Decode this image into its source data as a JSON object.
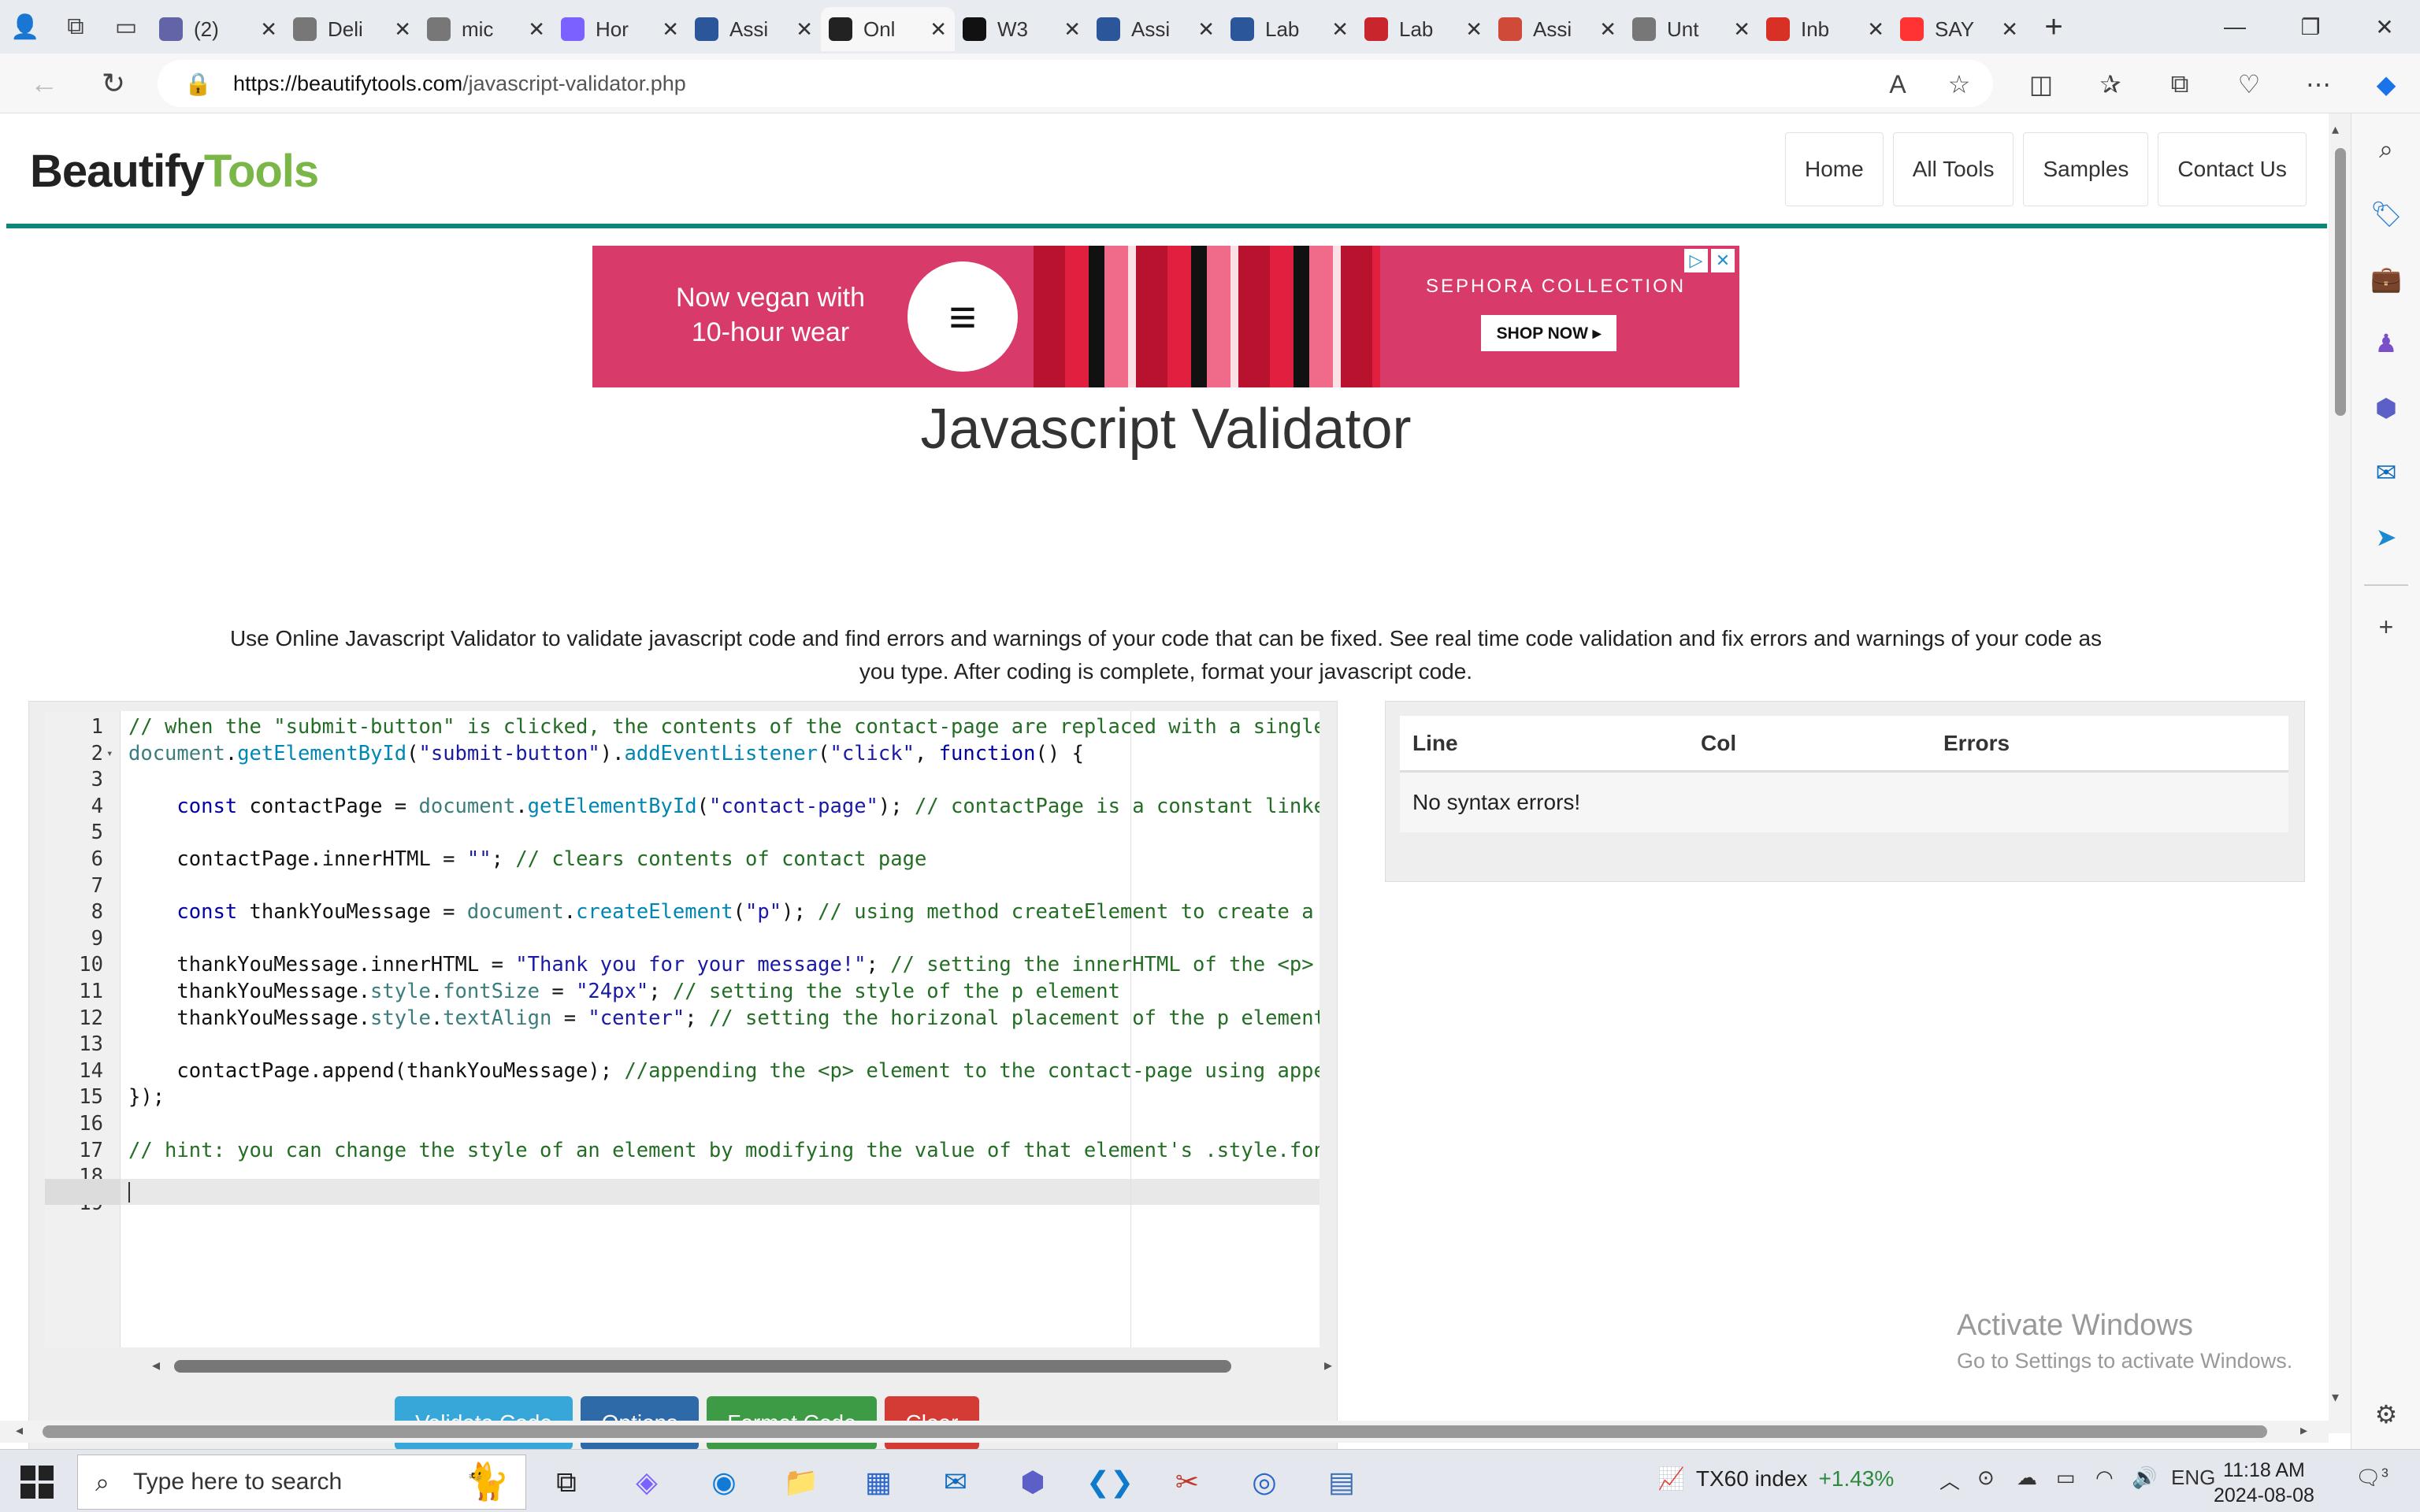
{
  "browser": {
    "tabs": [
      {
        "label": "(2)",
        "icon": "teams-icon",
        "color": "#6264a7",
        "active": false
      },
      {
        "label": "Deli",
        "icon": "document-icon",
        "color": "#777777",
        "active": false
      },
      {
        "label": "mic",
        "icon": "search-icon",
        "color": "#777777",
        "active": false
      },
      {
        "label": "Hor",
        "icon": "copilot-icon",
        "color": "#7b61ff",
        "active": false
      },
      {
        "label": "Assi",
        "icon": "word-icon",
        "color": "#2b579a",
        "active": false
      },
      {
        "label": "Onl",
        "icon": "beautifytools-icon",
        "color": "#222222",
        "active": true
      },
      {
        "label": "W3",
        "icon": "w3schools-icon",
        "color": "#111111",
        "active": false
      },
      {
        "label": "Assi",
        "icon": "word-icon",
        "color": "#2b579a",
        "active": false
      },
      {
        "label": "Lab",
        "icon": "word-icon",
        "color": "#2b579a",
        "active": false
      },
      {
        "label": "Lab",
        "icon": "pdf-icon",
        "color": "#c9252c",
        "active": false
      },
      {
        "label": "Assi",
        "icon": "brightspace-icon",
        "color": "#d04a3a",
        "active": false
      },
      {
        "label": "Unt",
        "icon": "document-icon",
        "color": "#777777",
        "active": false
      },
      {
        "label": "Inb",
        "icon": "gmail-icon",
        "color": "#d93025",
        "active": false
      },
      {
        "label": "SAY",
        "icon": "youtube-icon",
        "color": "#ff3333",
        "active": false
      }
    ],
    "url_host": "https://beautifytools.com",
    "url_path": "/javascript-validator.php"
  },
  "site": {
    "logo_part1": "Beautify",
    "logo_part2": "Tools",
    "nav": [
      "Home",
      "All Tools",
      "Samples",
      "Contact Us"
    ]
  },
  "ad": {
    "headline": "Now vegan with 10-hour wear",
    "brand": "SEPHORA COLLECTION",
    "cta": "SHOP NOW ▸"
  },
  "page": {
    "title": "Javascript Validator",
    "description": "Use Online Javascript Validator to validate javascript code and find errors and warnings of your code that can be fixed. See real time code validation and fix errors and warnings of your code as you type. After coding is complete, format your javascript code."
  },
  "editor": {
    "line_numbers": [
      "1",
      "2",
      "3",
      "4",
      "5",
      "6",
      "7",
      "8",
      "9",
      "10",
      "11",
      "12",
      "13",
      "14",
      "15",
      "16",
      "17",
      "18",
      "19"
    ],
    "lines": [
      [
        {
          "t": "// when the \"submit-button\" is clicked, the contents of the contact-page are replaced with a single",
          "c": "com"
        }
      ],
      [
        {
          "t": "document",
          "c": "obj"
        },
        {
          "t": "."
        },
        {
          "t": "getElementById",
          "c": "fn"
        },
        {
          "t": "("
        },
        {
          "t": "\"submit-button\"",
          "c": "str"
        },
        {
          "t": ")."
        },
        {
          "t": "addEventListener",
          "c": "fn"
        },
        {
          "t": "("
        },
        {
          "t": "\"click\"",
          "c": "str"
        },
        {
          "t": ", "
        },
        {
          "t": "function",
          "c": "kw"
        },
        {
          "t": "() {"
        }
      ],
      [],
      [
        {
          "t": "    "
        },
        {
          "t": "const",
          "c": "kw"
        },
        {
          "t": " contactPage = "
        },
        {
          "t": "document",
          "c": "obj"
        },
        {
          "t": "."
        },
        {
          "t": "getElementById",
          "c": "fn"
        },
        {
          "t": "("
        },
        {
          "t": "\"contact-page\"",
          "c": "str"
        },
        {
          "t": "); "
        },
        {
          "t": "// contactPage is a constant linke",
          "c": "com"
        }
      ],
      [],
      [
        {
          "t": "    contactPage.innerHTML = "
        },
        {
          "t": "\"\"",
          "c": "str"
        },
        {
          "t": "; "
        },
        {
          "t": "// clears contents of contact page",
          "c": "com"
        }
      ],
      [],
      [
        {
          "t": "    "
        },
        {
          "t": "const",
          "c": "kw"
        },
        {
          "t": " thankYouMessage = "
        },
        {
          "t": "document",
          "c": "obj"
        },
        {
          "t": "."
        },
        {
          "t": "createElement",
          "c": "fn"
        },
        {
          "t": "("
        },
        {
          "t": "\"p\"",
          "c": "str"
        },
        {
          "t": "); "
        },
        {
          "t": "// using method createElement to create a",
          "c": "com"
        }
      ],
      [],
      [
        {
          "t": "    thankYouMessage.innerHTML = "
        },
        {
          "t": "\"Thank you for your message!\"",
          "c": "str"
        },
        {
          "t": "; "
        },
        {
          "t": "// setting the innerHTML of the <p>",
          "c": "com"
        }
      ],
      [
        {
          "t": "    thankYouMessage."
        },
        {
          "t": "style",
          "c": "obj"
        },
        {
          "t": "."
        },
        {
          "t": "fontSize",
          "c": "obj"
        },
        {
          "t": " = "
        },
        {
          "t": "\"24px\"",
          "c": "str"
        },
        {
          "t": "; "
        },
        {
          "t": "// setting the style of the p element",
          "c": "com"
        }
      ],
      [
        {
          "t": "    thankYouMessage."
        },
        {
          "t": "style",
          "c": "obj"
        },
        {
          "t": "."
        },
        {
          "t": "textAlign",
          "c": "obj"
        },
        {
          "t": " = "
        },
        {
          "t": "\"center\"",
          "c": "str"
        },
        {
          "t": "; "
        },
        {
          "t": "// setting the horizonal placement of the p element",
          "c": "com"
        }
      ],
      [],
      [
        {
          "t": "    contactPage.append(thankYouMessage); "
        },
        {
          "t": "//appending the <p> element to the contact-page using appe",
          "c": "com"
        }
      ],
      [
        {
          "t": "});"
        }
      ],
      [],
      [
        {
          "t": "// hint: you can change the style of an element by modifying the value of that element's .style.fon",
          "c": "com"
        }
      ],
      [],
      []
    ]
  },
  "buttons": {
    "validate": "Validate Code",
    "options": "Options",
    "format": "Format Code",
    "clear": "Clear"
  },
  "errors": {
    "col_line": "Line",
    "col_col": "Col",
    "col_errors": "Errors",
    "message": "No syntax errors!"
  },
  "watermark": {
    "line1": "Activate Windows",
    "line2": "Go to Settings to activate Windows."
  },
  "taskbar": {
    "search_placeholder": "Type here to search",
    "ticker_name": "TX60 index",
    "ticker_change": "+1.43%",
    "language": "ENG",
    "time": "11:18 AM",
    "date": "2024-08-08",
    "notification_count": "3"
  },
  "colors": {
    "accent_teal": "#0e8679",
    "logo_green": "#7ab648",
    "btn_validate": "#37a7d9",
    "btn_options": "#2e6aa8",
    "btn_format": "#3d9a45",
    "btn_clear": "#d53b35"
  }
}
